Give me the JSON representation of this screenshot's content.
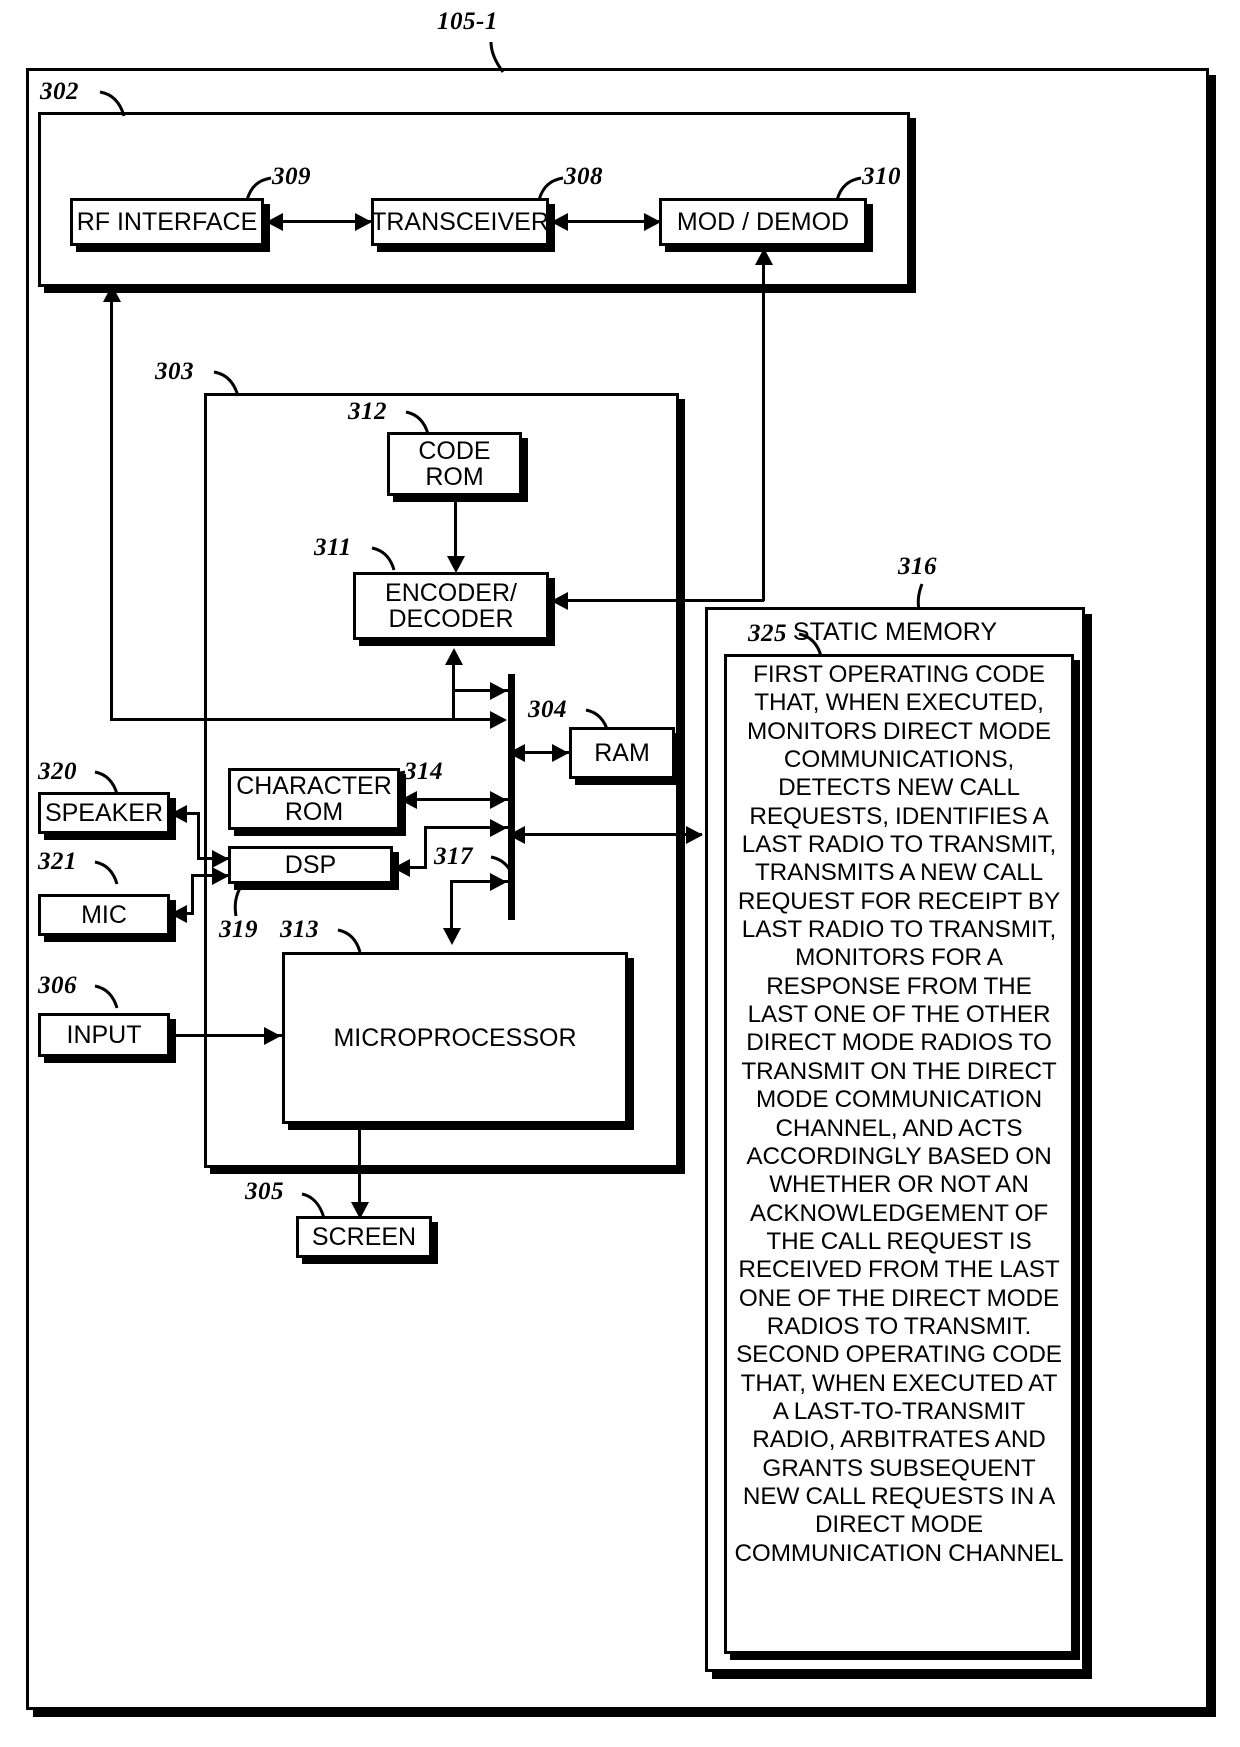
{
  "figure": {
    "top_label": "105-1",
    "outer_ref": "105-1"
  },
  "refs": {
    "radio": "105-1",
    "rf_section": "302",
    "rf_interface": "309",
    "transceiver": "308",
    "mod_demod": "310",
    "processing_section": "303",
    "code_rom": "312",
    "encoder_decoder": "311",
    "bus": "304",
    "character_rom": "314",
    "dsp_bus": "317",
    "dsp": "319",
    "microprocessor": "313",
    "speaker": "320",
    "mic": "321",
    "input": "306",
    "screen": "305",
    "static_memory": "316",
    "operating_code": "325"
  },
  "blocks": {
    "rf_interface": "RF INTERFACE",
    "transceiver": "TRANSCEIVER",
    "mod_demod": "MOD / DEMOD",
    "code_rom_line1": "CODE",
    "code_rom_line2": "ROM",
    "encoder_decoder_line1": "ENCODER/",
    "encoder_decoder_line2": "DECODER",
    "ram": "RAM",
    "character_rom_line1": "CHARACTER",
    "character_rom_line2": "ROM",
    "dsp": "DSP",
    "speaker": "SPEAKER",
    "mic": "MIC",
    "input": "INPUT",
    "microprocessor": "MICROPROCESSOR",
    "screen": "SCREEN"
  },
  "static_memory": {
    "title": "STATIC MEMORY",
    "operating_code_text": "FIRST OPERATING CODE THAT, WHEN EXECUTED, MONITORS DIRECT MODE COMMUNICATIONS, DETECTS NEW CALL REQUESTS, IDENTIFIES A LAST RADIO TO TRANSMIT, TRANSMITS A NEW CALL REQUEST FOR RECEIPT BY LAST RADIO TO TRANSMIT, MONITORS FOR A RESPONSE FROM THE LAST ONE OF THE OTHER DIRECT MODE RADIOS TO TRANSMIT ON THE DIRECT MODE COMMUNICATION CHANNEL, AND ACTS ACCORDINGLY BASED ON WHETHER OR NOT AN ACKNOWLEDGEMENT OF THE CALL REQUEST IS RECEIVED FROM THE LAST ONE OF THE DIRECT MODE RADIOS TO TRANSMIT. SECOND OPERATING CODE THAT, WHEN EXECUTED AT A LAST-TO-TRANSMIT RADIO, ARBITRATES AND GRANTS SUBSEQUENT NEW CALL REQUESTS IN A DIRECT MODE COMMUNICATION CHANNEL"
  },
  "colors": {
    "ink": "#000000",
    "paper": "#ffffff"
  }
}
